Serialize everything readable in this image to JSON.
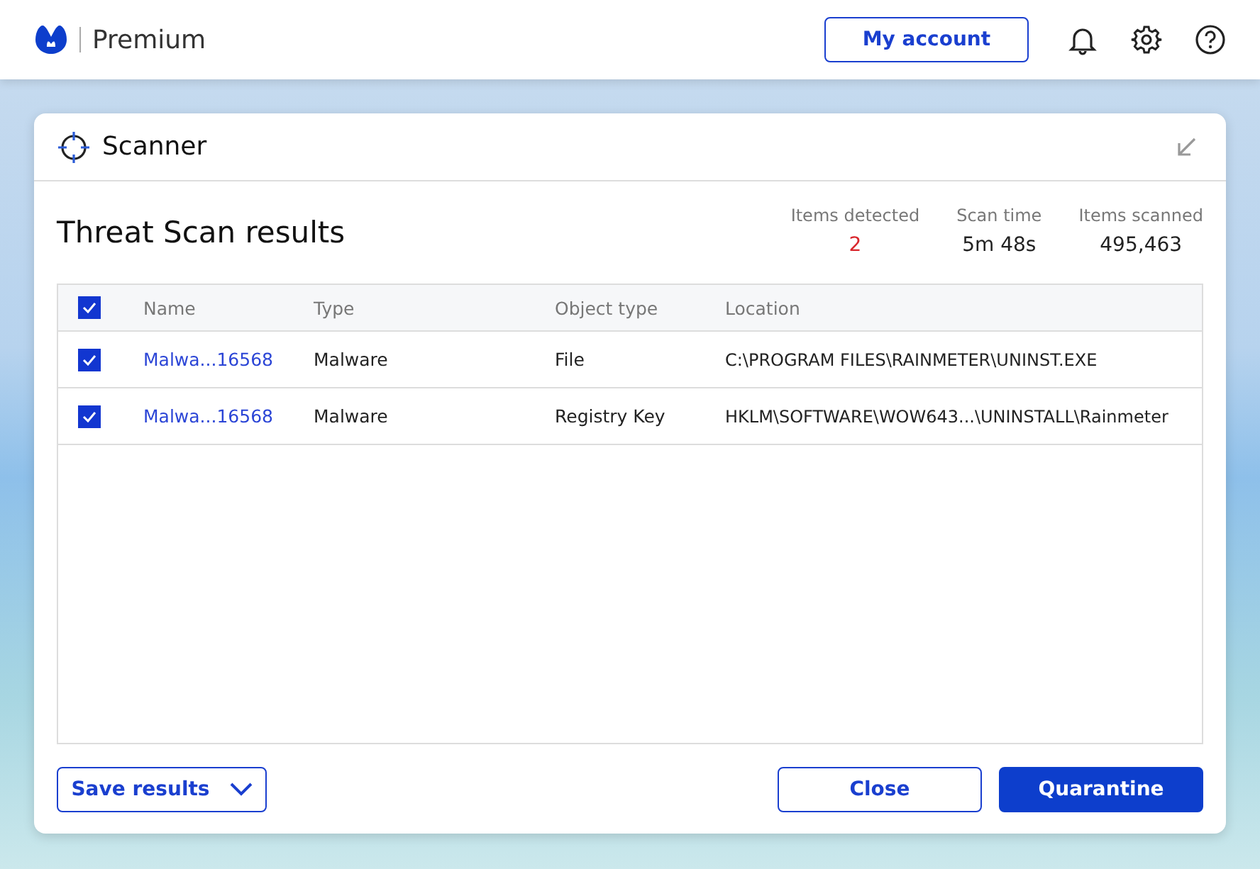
{
  "app": {
    "product": "Premium"
  },
  "header_actions": {
    "account_button": "My account"
  },
  "panel": {
    "title": "Scanner"
  },
  "results": {
    "title": "Threat Scan results",
    "stats": [
      {
        "label": "Items detected",
        "value": "2",
        "alert": true
      },
      {
        "label": "Scan time",
        "value": "5m 48s",
        "alert": false
      },
      {
        "label": "Items scanned",
        "value": "495,463",
        "alert": false
      }
    ]
  },
  "table": {
    "select_all_checked": true,
    "columns": [
      "Name",
      "Type",
      "Object type",
      "Location"
    ],
    "rows": [
      {
        "checked": true,
        "cells": [
          "Malwa...16568",
          "Malware",
          "File",
          "C:\\PROGRAM FILES\\RAINMETER\\UNINST.EXE"
        ]
      },
      {
        "checked": true,
        "cells": [
          "Malwa...16568",
          "Malware",
          "Registry Key",
          "HKLM\\SOFTWARE\\WOW643...\\UNINSTALL\\Rainmeter"
        ]
      }
    ]
  },
  "footer": {
    "save_button": "Save results",
    "close_button": "Close",
    "quarantine_button": "Quarantine"
  }
}
